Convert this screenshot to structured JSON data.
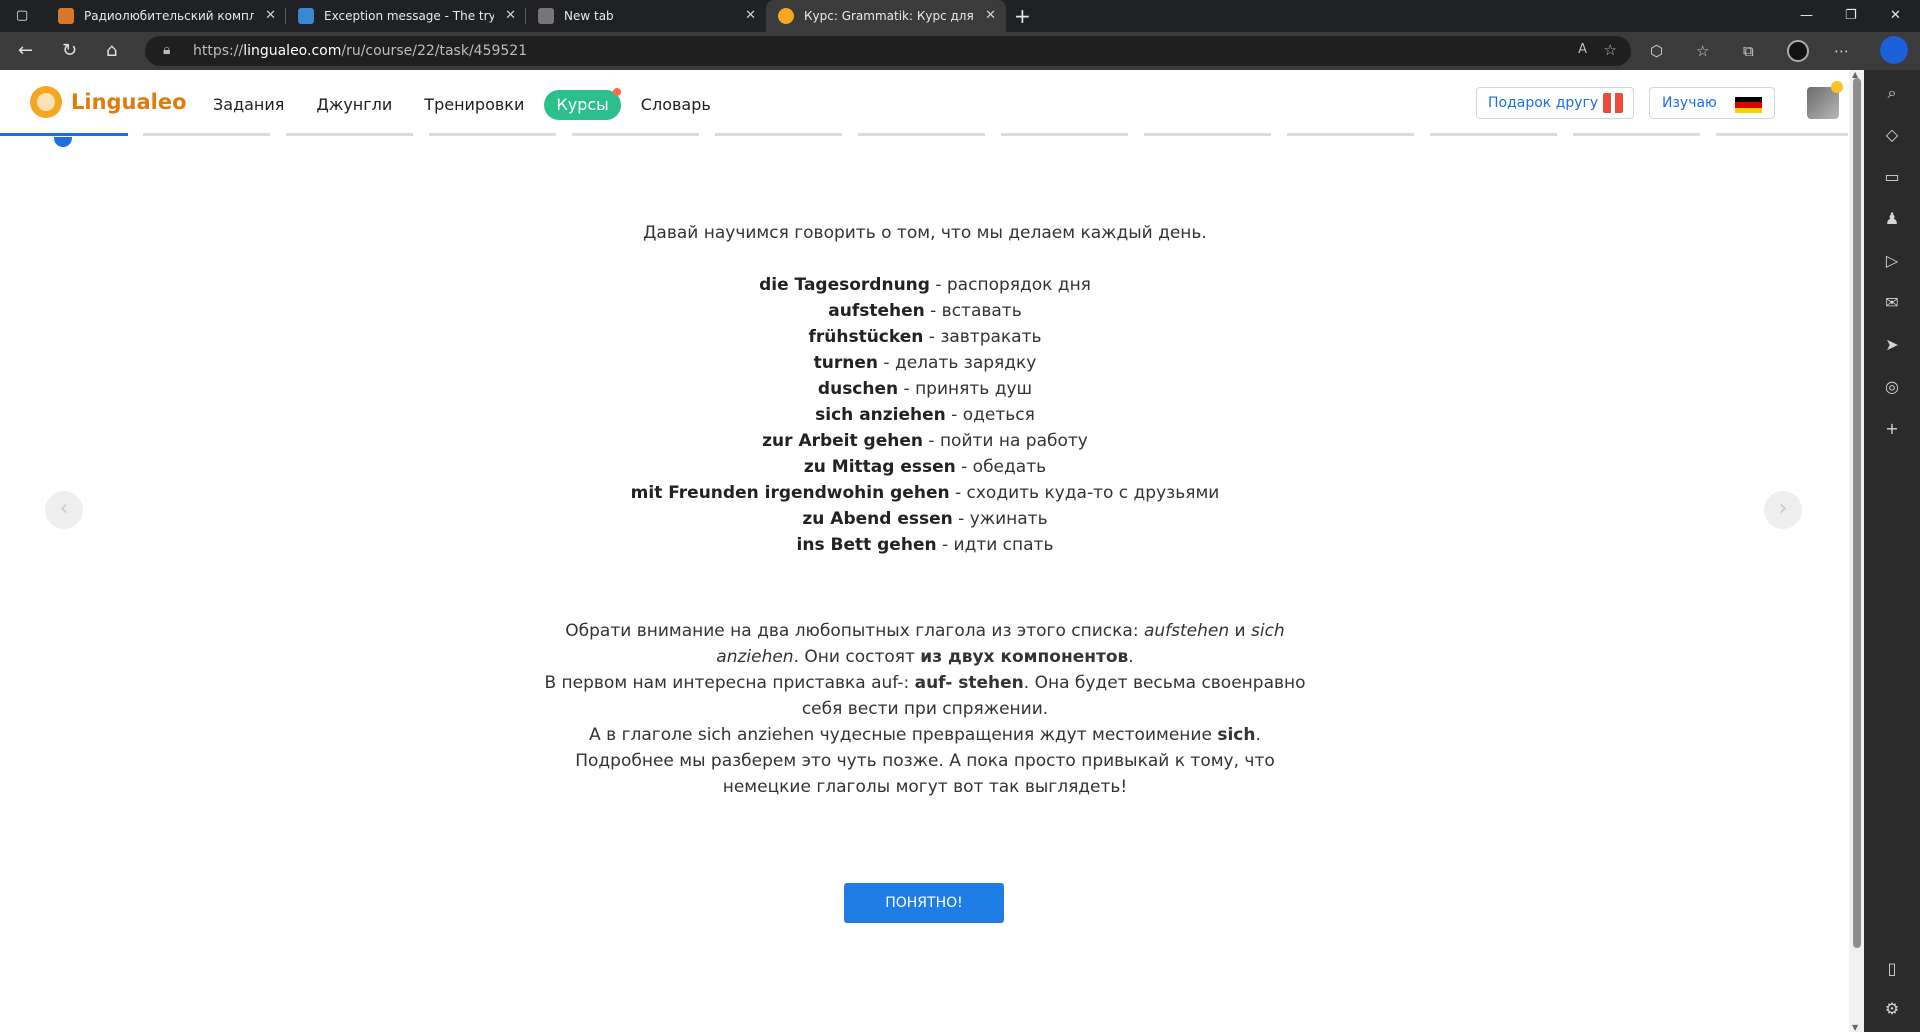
{
  "browser": {
    "tabs": [
      {
        "title": "Радиолюбительский комплект",
        "favicon_color": "#d9782c"
      },
      {
        "title": "Exception message - The try-cat",
        "favicon_color": "#3a87d6"
      },
      {
        "title": "New tab",
        "favicon_color": "#777777"
      },
      {
        "title": "Курс: Grammatik: Курс для начи",
        "favicon_color": "#f5a623"
      }
    ],
    "new_tab_label": "+",
    "url_prefix": "https://",
    "url_domain": "lingualeo.com",
    "url_path": "/ru/course/22/task/459521"
  },
  "site": {
    "logo_text": "Lingualeo",
    "nav": [
      "Задания",
      "Джунгли",
      "Тренировки",
      "Курсы",
      "Словарь"
    ],
    "active_nav": "Курсы",
    "gift_label": "Подарок другу",
    "learn_label": "Изучаю",
    "accent": "#1e6fe0",
    "active_color": "#2bbf8b"
  },
  "lesson": {
    "intro": "Давай научимся говорить о том, что мы делаем каждый день.",
    "vocab": [
      {
        "de": "die Tagesordnung",
        "ru": " - распорядок дня"
      },
      {
        "de": "aufstehen",
        "ru": " - вставать"
      },
      {
        "de": "frühstücken",
        "ru": " - завтракать"
      },
      {
        "de": "turnen",
        "ru": " - делать зарядку"
      },
      {
        "de": "duschen",
        "ru": " - принять душ"
      },
      {
        "de": "sich anziehen",
        "ru": " - одеться"
      },
      {
        "de": "zur Arbeit gehen",
        "ru": " - пойти на работу"
      },
      {
        "de": "zu Mittag essen",
        "ru": " - обедать"
      },
      {
        "de": "mit Freunden irgendwohin gehen",
        "ru": " - сходить куда-то с друзьями"
      },
      {
        "de": "zu Abend essen",
        "ru": " - ужинать"
      },
      {
        "de": "ins Bett gehen",
        "ru": " - идти спать"
      }
    ],
    "note": {
      "p1_a": "Обрати внимание на два любопытных глагола из этого списка: ",
      "p1_i1": "aufstehen",
      "p1_b": " и ",
      "p1_i2": "sich anziehen",
      "p1_c": ". Они состоят ",
      "p1_bold": "из двух компонентов",
      "p1_d": ".",
      "p2_a": "В первом нам интересна приставка auf-: ",
      "p2_bold": "auf- stehen",
      "p2_b": ". Она будет весьма своенравно себя вести при спряжении.",
      "p3_a": "А в глаголе sich anziehen чудесные превращения ждут местоимение ",
      "p3_bold": "sich",
      "p3_b": ".",
      "p4": "Подробнее мы разберем это чуть позже. А пока просто привыкай к тому, что немецкие глаголы могут вот так выглядеть!"
    },
    "ok_label": "ПОНЯТНО!",
    "progress": {
      "total_steps": 13,
      "completed_steps": 1
    }
  }
}
